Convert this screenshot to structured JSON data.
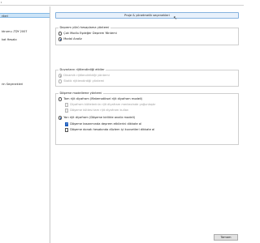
{
  "window": {
    "title": "ı"
  },
  "sidebar": {
    "items": [
      {
        "label": ""
      },
      {
        "label": "rileri"
      },
      {
        "label": ""
      },
      {
        "label": "ktrumu -TDY 2007"
      },
      {
        "label": "kat Hesabı"
      },
      {
        "label": ""
      },
      {
        "label": ""
      },
      {
        "label": ""
      },
      {
        "label": ""
      },
      {
        "label": ""
      },
      {
        "label": ""
      },
      {
        "label": "rin Seçenekleri"
      },
      {
        "label": ""
      }
    ],
    "selected_index": 1
  },
  "project_button": {
    "label": "Proje & yönetmelik seçenekleri"
  },
  "load_distribution": {
    "title": "Deprem yükü hesaplama yöntemi",
    "options": [
      {
        "label": "Çok Modlu Eşdeğer Deprem Yöntemi",
        "checked": false
      },
      {
        "label": "Modal Analiz",
        "checked": true
      }
    ]
  },
  "wall_stiffness": {
    "title": "Duvarların rijitlendirdiği etkiler",
    "options": [
      {
        "label": "Dinamik rijitlendirildiği yöntemi",
        "checked": true
      },
      {
        "label": "Statik rijitlendirdiği yöntemi",
        "checked": false
      }
    ]
  },
  "slab_modeling": {
    "title": "Döşeme modelleme yöntemi",
    "option_a": {
      "label": "Tam rijit diyafram (Matematiksel rijit diyafram modeli)",
      "checked": false
    },
    "sub_a": [
      {
        "label": "Diyafram kütlelerinin rijit diyafram merkezinde yoğunlaştır",
        "checked": false
      },
      {
        "label": "Döşeme kütlesi tam rijit diyafram kullan",
        "checked": false
      }
    ],
    "option_b": {
      "label": "Yarı rijit diyafram (Döşeme birlikte analiz modeli)",
      "checked": true
    },
    "sub_b": [
      {
        "label": "Döşeme tasarımında deprem etkilerini dikkate al",
        "checked": true
      },
      {
        "label": "Döşeme donatı hesabında düzlem içi kuvvetleri dikkate al",
        "checked": false
      }
    ]
  },
  "footer": {
    "cancel_label": "Tamam"
  }
}
